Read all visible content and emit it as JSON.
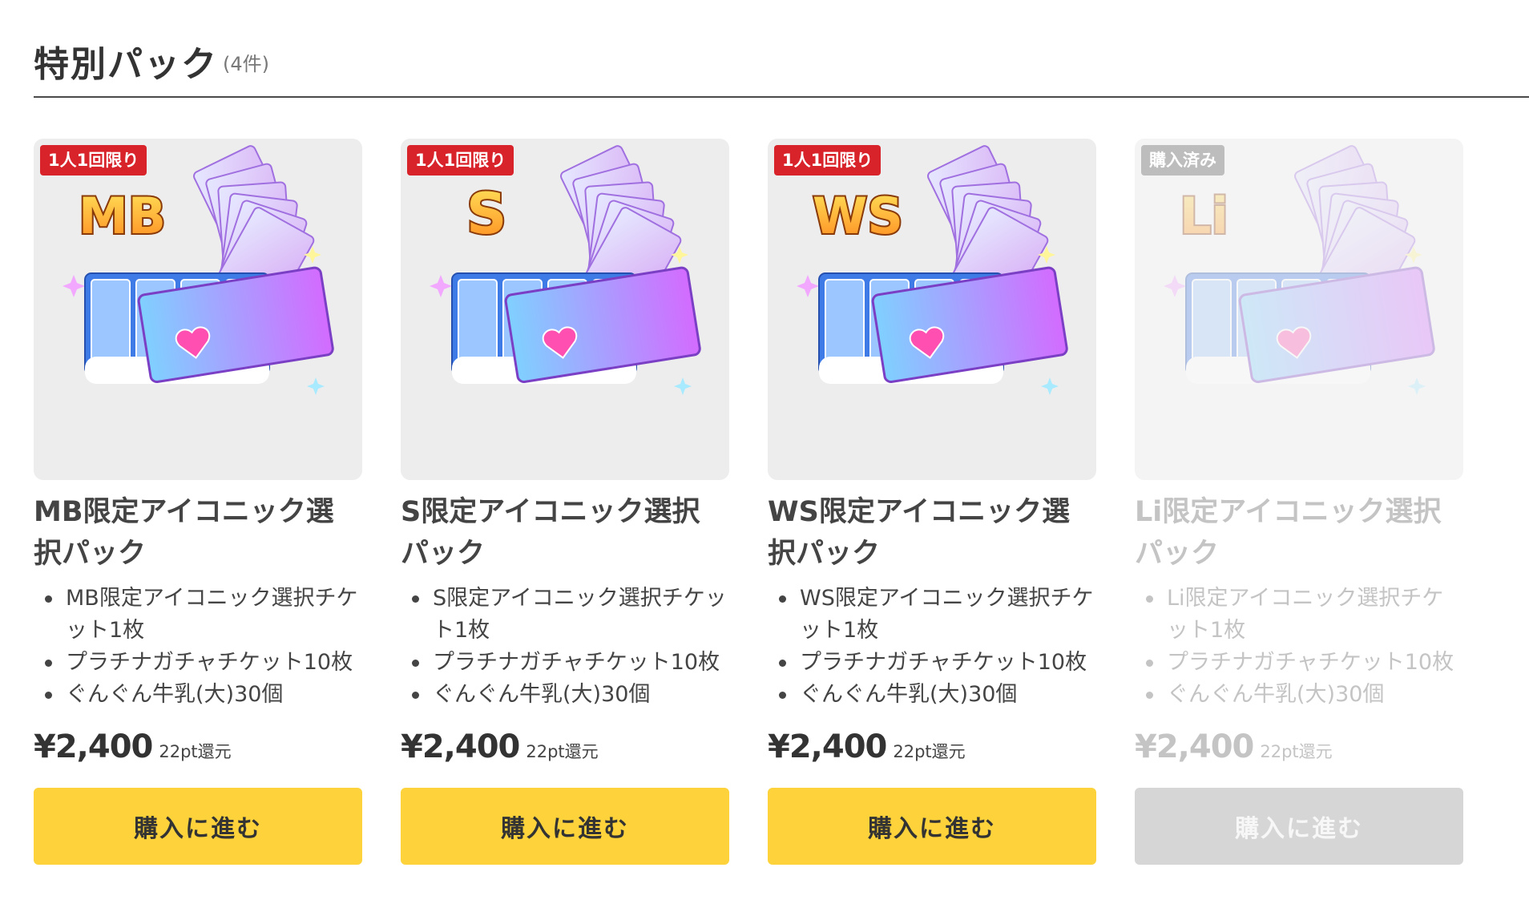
{
  "section": {
    "title": "特別パック",
    "count": "(4件)"
  },
  "colors": {
    "accent": "#fdd23a",
    "limit_tag": "#d8232a",
    "purchased_tag": "#bdbdbd",
    "disabled": "#d6d6d6"
  },
  "cards": [
    {
      "tag": "1人1回限り",
      "badge": "MB",
      "title": "MB限定アイコニック選択パック",
      "items": [
        "MB限定アイコニック選択チケット1枚",
        "プラチナガチャチケット10枚",
        "ぐんぐん牛乳(大)30個"
      ],
      "price": "¥2,400",
      "points": "22pt還元",
      "button": "購入に進む",
      "status": "available"
    },
    {
      "tag": "1人1回限り",
      "badge": "S",
      "title": "S限定アイコニック選択パック",
      "items": [
        "S限定アイコニック選択チケット1枚",
        "プラチナガチャチケット10枚",
        "ぐんぐん牛乳(大)30個"
      ],
      "price": "¥2,400",
      "points": "22pt還元",
      "button": "購入に進む",
      "status": "available"
    },
    {
      "tag": "1人1回限り",
      "badge": "WS",
      "title": "WS限定アイコニック選択パック",
      "items": [
        "WS限定アイコニック選択チケット1枚",
        "プラチナガチャチケット10枚",
        "ぐんぐん牛乳(大)30個"
      ],
      "price": "¥2,400",
      "points": "22pt還元",
      "button": "購入に進む",
      "status": "available"
    },
    {
      "tag": "購入済み",
      "badge": "Li",
      "title": "Li限定アイコニック選択パック",
      "items": [
        "Li限定アイコニック選択チケット1枚",
        "プラチナガチャチケット10枚",
        "ぐんぐん牛乳(大)30個"
      ],
      "price": "¥2,400",
      "points": "22pt還元",
      "button": "購入に進む",
      "status": "purchased"
    }
  ]
}
